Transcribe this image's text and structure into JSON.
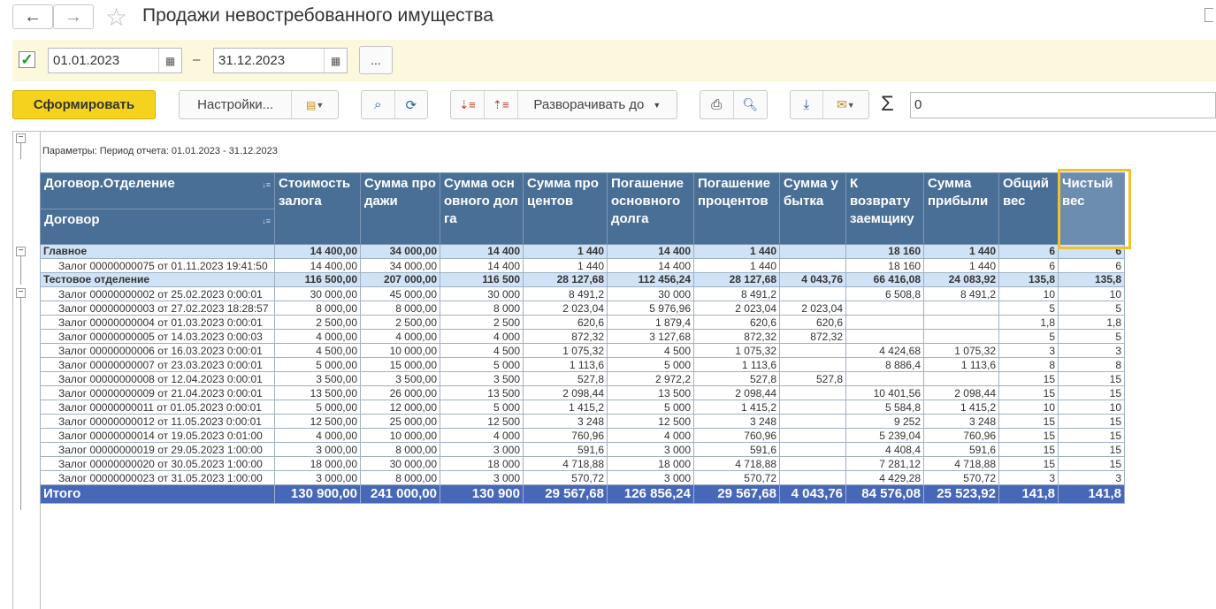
{
  "window": {
    "title": "Продажи невостребованного имущества"
  },
  "filter": {
    "checked": true,
    "date_from": "01.01.2023",
    "dash": "–",
    "date_to": "31.12.2023",
    "more_label": "..."
  },
  "toolbar": {
    "generate_label": "Сформировать",
    "settings_label": "Настройки...",
    "expand_label": "Разворачивать до",
    "sum_symbol": "Σ",
    "sum_value": "0"
  },
  "params": {
    "text": "Параметры:  Период отчета: 01.01.2023 - 31.12.2023"
  },
  "columns": {
    "c0a": "Договор.Отделение",
    "c0b": "Договор",
    "c1": "Стоимость залога",
    "c2": "Сумма продажи",
    "c3": "Сумма основного долга",
    "c4": "Сумма процентов",
    "c5": "Погашение основного долга",
    "c6": "Погашение процентов",
    "c7": "Сумма убытка",
    "c8": "К возврату заемщику",
    "c9": "Сумма прибыли",
    "c10": "Общий вес",
    "c11": "Чистый вес"
  },
  "groups": [
    {
      "name": "Главное",
      "values": [
        "14 400,00",
        "34 000,00",
        "14 400",
        "1 440",
        "14 400",
        "1 440",
        "",
        "18 160",
        "1 440",
        "6",
        "6"
      ],
      "rows": [
        {
          "name": "Залог 00000000075 от 01.11.2023 19:41:50",
          "values": [
            "14 400,00",
            "34 000,00",
            "14 400",
            "1 440",
            "14 400",
            "1 440",
            "",
            "18 160",
            "1 440",
            "6",
            "6"
          ]
        }
      ]
    },
    {
      "name": "Тестовое отделение",
      "values": [
        "116 500,00",
        "207 000,00",
        "116 500",
        "28 127,68",
        "112 456,24",
        "28 127,68",
        "4 043,76",
        "66 416,08",
        "24 083,92",
        "135,8",
        "135,8"
      ],
      "rows": [
        {
          "name": "Залог 00000000002 от 25.02.2023 0:00:01",
          "values": [
            "30 000,00",
            "45 000,00",
            "30 000",
            "8 491,2",
            "30 000",
            "8 491,2",
            "",
            "6 508,8",
            "8 491,2",
            "10",
            "10"
          ]
        },
        {
          "name": "Залог 00000000003 от 27.02.2023 18:28:57",
          "values": [
            "8 000,00",
            "8 000,00",
            "8 000",
            "2 023,04",
            "5 976,96",
            "2 023,04",
            "2 023,04",
            "",
            "",
            "5",
            "5"
          ]
        },
        {
          "name": "Залог 00000000004 от 01.03.2023 0:00:01",
          "values": [
            "2 500,00",
            "2 500,00",
            "2 500",
            "620,6",
            "1 879,4",
            "620,6",
            "620,6",
            "",
            "",
            "1,8",
            "1,8"
          ]
        },
        {
          "name": "Залог 00000000005 от 14.03.2023 0:00:03",
          "values": [
            "4 000,00",
            "4 000,00",
            "4 000",
            "872,32",
            "3 127,68",
            "872,32",
            "872,32",
            "",
            "",
            "5",
            "5"
          ]
        },
        {
          "name": "Залог 00000000006 от 16.03.2023 0:00:01",
          "values": [
            "4 500,00",
            "10 000,00",
            "4 500",
            "1 075,32",
            "4 500",
            "1 075,32",
            "",
            "4 424,68",
            "1 075,32",
            "3",
            "3"
          ]
        },
        {
          "name": "Залог 00000000007 от 23.03.2023 0:00:01",
          "values": [
            "5 000,00",
            "15 000,00",
            "5 000",
            "1 113,6",
            "5 000",
            "1 113,6",
            "",
            "8 886,4",
            "1 113,6",
            "8",
            "8"
          ]
        },
        {
          "name": "Залог 00000000008 от 12.04.2023 0:00:01",
          "values": [
            "3 500,00",
            "3 500,00",
            "3 500",
            "527,8",
            "2 972,2",
            "527,8",
            "527,8",
            "",
            "",
            "15",
            "15"
          ]
        },
        {
          "name": "Залог 00000000009 от 21.04.2023 0:00:01",
          "values": [
            "13 500,00",
            "26 000,00",
            "13 500",
            "2 098,44",
            "13 500",
            "2 098,44",
            "",
            "10 401,56",
            "2 098,44",
            "15",
            "15"
          ]
        },
        {
          "name": "Залог 00000000011 от 01.05.2023 0:00:01",
          "values": [
            "5 000,00",
            "12 000,00",
            "5 000",
            "1 415,2",
            "5 000",
            "1 415,2",
            "",
            "5 584,8",
            "1 415,2",
            "10",
            "10"
          ]
        },
        {
          "name": "Залог 00000000012 от 11.05.2023 0:00:01",
          "values": [
            "12 500,00",
            "25 000,00",
            "12 500",
            "3 248",
            "12 500",
            "3 248",
            "",
            "9 252",
            "3 248",
            "15",
            "15"
          ]
        },
        {
          "name": "Залог 00000000014 от 19.05.2023 0:01:00",
          "values": [
            "4 000,00",
            "10 000,00",
            "4 000",
            "760,96",
            "4 000",
            "760,96",
            "",
            "5 239,04",
            "760,96",
            "15",
            "15"
          ]
        },
        {
          "name": "Залог 00000000019 от 29.05.2023 1:00:00",
          "values": [
            "3 000,00",
            "8 000,00",
            "3 000",
            "591,6",
            "3 000",
            "591,6",
            "",
            "4 408,4",
            "591,6",
            "15",
            "15"
          ]
        },
        {
          "name": "Залог 00000000020 от 30.05.2023 1:00:00",
          "values": [
            "18 000,00",
            "30 000,00",
            "18 000",
            "4 718,88",
            "18 000",
            "4 718,88",
            "",
            "7 281,12",
            "4 718,88",
            "15",
            "15"
          ]
        },
        {
          "name": "Залог 00000000023 от 31.05.2023 1:00:00",
          "values": [
            "3 000,00",
            "8 000,00",
            "3 000",
            "570,72",
            "3 000",
            "570,72",
            "",
            "4 429,28",
            "570,72",
            "3",
            "3"
          ]
        }
      ]
    }
  ],
  "total": {
    "name": "Итого",
    "values": [
      "130 900,00",
      "241 000,00",
      "130 900",
      "29 567,68",
      "126 856,24",
      "29 567,68",
      "4 043,76",
      "84 576,08",
      "25 523,92",
      "141,8",
      "141,8"
    ]
  }
}
